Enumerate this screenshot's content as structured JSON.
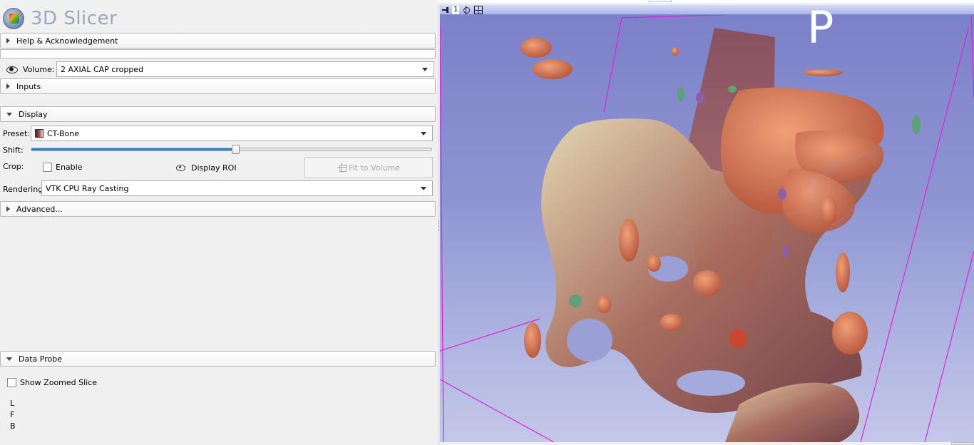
{
  "app": {
    "title": "3D Slicer"
  },
  "sections": {
    "help": "Help & Acknowledgement",
    "inputs": "Inputs",
    "display": "Display",
    "advanced": "Advanced...",
    "data_probe": "Data Probe"
  },
  "volume": {
    "label": "Volume:",
    "value": "2 AXIAL CAP cropped"
  },
  "display": {
    "preset_label": "Preset:",
    "preset_value": "CT-Bone",
    "shift_label": "Shift:",
    "shift_fraction": 0.51,
    "crop_label": "Crop:",
    "enable_label": "Enable",
    "enable_checked": false,
    "display_roi_label": "Display ROI",
    "fit_button": "Fit to Volume",
    "rendering_label": "Rendering:",
    "rendering_value": "VTK CPU Ray Casting"
  },
  "data_probe": {
    "show_zoomed_label": "Show Zoomed Slice",
    "show_zoomed_checked": false,
    "coords": [
      "L",
      "F",
      "B"
    ]
  },
  "view3d": {
    "view_number": "1",
    "orientation_letter": "P",
    "background_top": "#7b80c8",
    "background_bottom": "#c3c7e8",
    "roi_box_color": "#e020e0"
  },
  "icons": {
    "logo": "slicer-logo-icon",
    "eye": "eye-icon",
    "roi": "display-roi-icon",
    "fit": "fit-to-volume-icon",
    "pin": "pin-icon",
    "center": "center-view-icon",
    "layout": "layout-icon"
  }
}
